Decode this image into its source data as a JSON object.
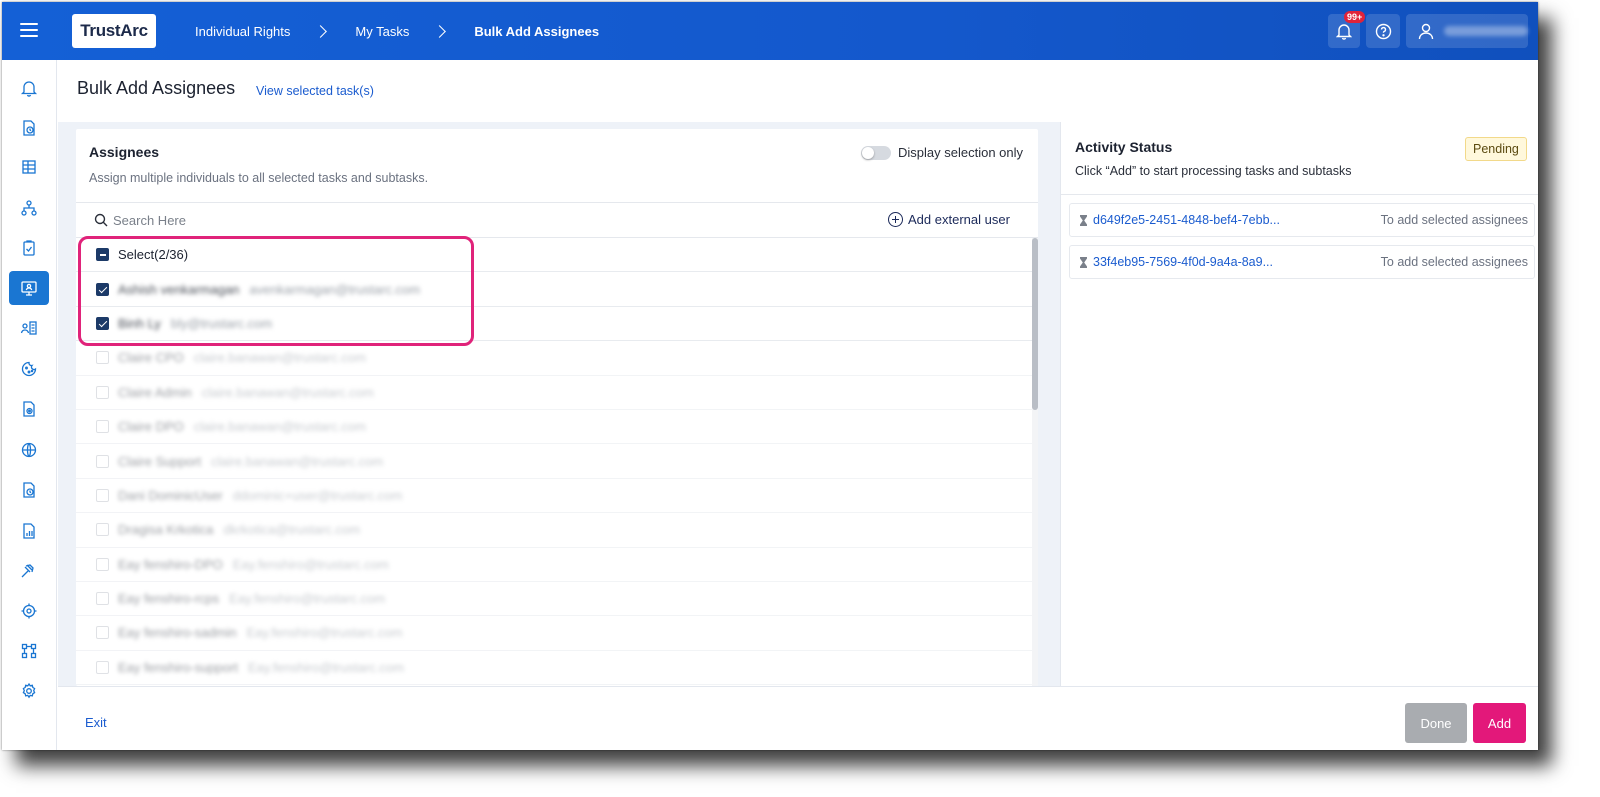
{
  "app": {
    "logo_text": "TrustArc"
  },
  "breadcrumbs": [
    {
      "label": "Individual Rights"
    },
    {
      "label": "My Tasks"
    },
    {
      "label": "Bulk Add Assignees"
    }
  ],
  "topbar": {
    "notifications_badge": "99+",
    "user_name": "Mary Cordelio"
  },
  "sidebar": {
    "items": [
      {
        "icon": "bell-icon"
      },
      {
        "icon": "document-clock-icon"
      },
      {
        "icon": "table-icon"
      },
      {
        "icon": "hierarchy-icon"
      },
      {
        "icon": "clipboard-check-icon"
      },
      {
        "icon": "monitor-user-icon",
        "active": true
      },
      {
        "icon": "user-list-icon"
      },
      {
        "icon": "cookie-icon"
      },
      {
        "icon": "document-gear-icon"
      },
      {
        "icon": "globe-icon"
      },
      {
        "icon": "document-clock-icon"
      },
      {
        "icon": "report-chart-icon"
      },
      {
        "icon": "gavel-icon"
      },
      {
        "icon": "target-gear-icon"
      },
      {
        "icon": "workflow-icon"
      },
      {
        "icon": "settings-icon"
      }
    ]
  },
  "page": {
    "title": "Bulk Add Assignees",
    "view_selected_link": "View selected task(s)"
  },
  "assignees": {
    "title": "Assignees",
    "subtitle": "Assign multiple individuals to all selected tasks and subtasks.",
    "toggle_label": "Display selection only",
    "search_placeholder": "Search Here",
    "add_external_label": "Add external user",
    "select_all_label": "Select(2/36)",
    "rows": [
      {
        "name": "Ashish venkarmagan",
        "email": "avenkarmagan@trustarc.com",
        "checked": true
      },
      {
        "name": "Binh Ly",
        "email": "bly@trustarc.com",
        "checked": true
      },
      {
        "name": "Claire CPO",
        "email": "claire.banawan@trustarc.com",
        "checked": false
      },
      {
        "name": "Claire Admin",
        "email": "claire.banawan@trustarc.com",
        "checked": false
      },
      {
        "name": "Claire DPO",
        "email": "claire.banawan@trustarc.com",
        "checked": false
      },
      {
        "name": "Claire Support",
        "email": "claire.banawan@trustarc.com",
        "checked": false
      },
      {
        "name": "Dani DominicUser",
        "email": "ddominic+user@trustarc.com",
        "checked": false
      },
      {
        "name": "Dragisa Krkotica",
        "email": "dkrkotica@trustarc.com",
        "checked": false
      },
      {
        "name": "Eay fenshiro-DPO",
        "email": "Eay.fenshiro@trustarc.com",
        "checked": false
      },
      {
        "name": "Eay fenshiro-rcps",
        "email": "Eay.fenshiro@trustarc.com",
        "checked": false
      },
      {
        "name": "Eay fenshiro-sadmin",
        "email": "Eay.fenshiro@trustarc.com",
        "checked": false
      },
      {
        "name": "Eay fenshiro-support",
        "email": "Eay.fenshiro@trustarc.com",
        "checked": false
      }
    ]
  },
  "activity": {
    "title": "Activity Status",
    "subtitle": "Click “Add” to start processing tasks and subtasks",
    "status_badge": "Pending",
    "items": [
      {
        "task_id": "d649f2e5-2451-4848-bef4-7ebb...",
        "status": "To add selected assignees"
      },
      {
        "task_id": "33f4eb95-7569-4f0d-9a4a-8a9...",
        "status": "To add selected assignees"
      }
    ]
  },
  "footer": {
    "exit_label": "Exit",
    "done_label": "Done",
    "add_label": "Add"
  },
  "colors": {
    "topbar": "#1460d6",
    "accent_blue": "#1b5ccf",
    "add_button": "#e3187a",
    "highlight_annotation": "#e0237a",
    "checkbox_checked": "#1c3a68"
  }
}
